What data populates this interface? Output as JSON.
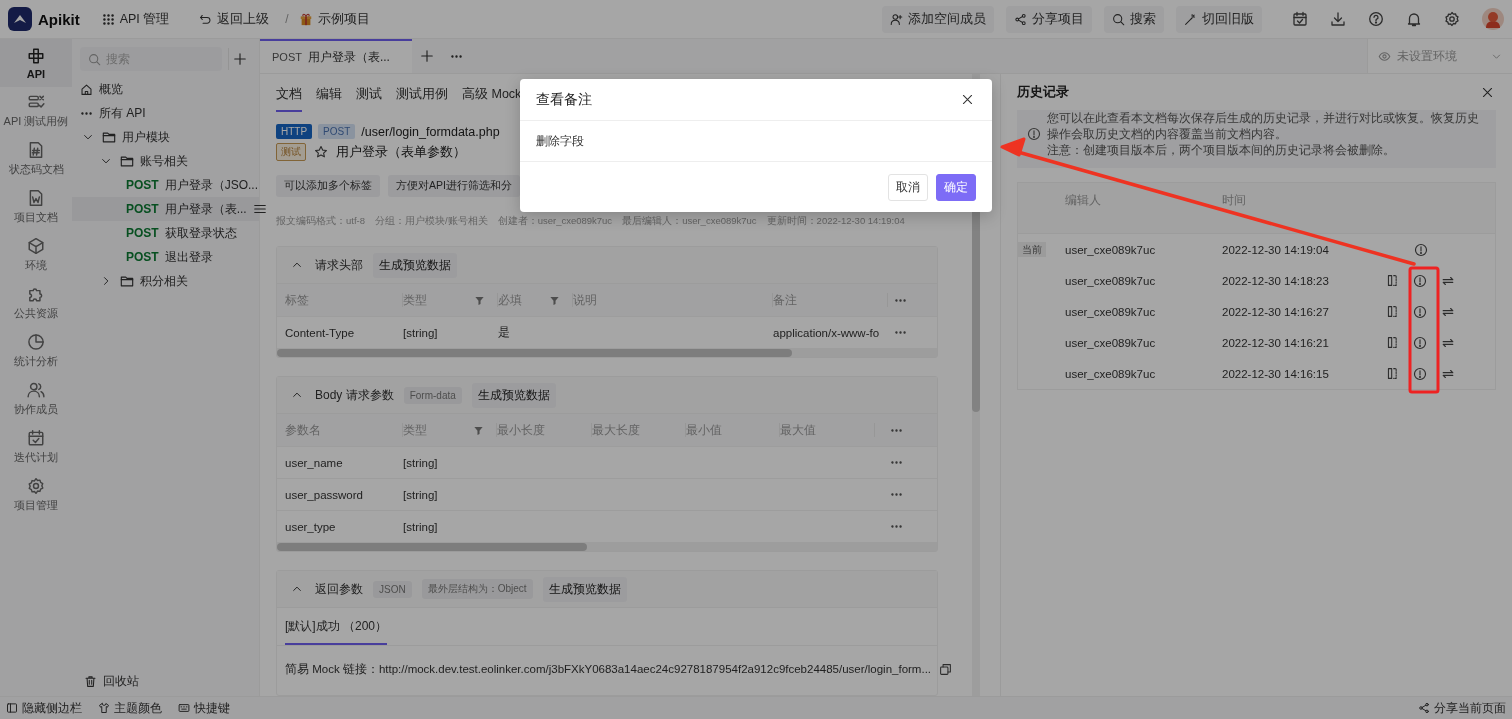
{
  "app": {
    "name": "Apikit"
  },
  "topbar": {
    "module": "API 管理",
    "back": "返回上级",
    "separator": "/",
    "project": "示例项目",
    "actions": [
      "添加空间成员",
      "分享项目",
      "搜索",
      "切回旧版"
    ]
  },
  "nav": [
    {
      "label": "API",
      "selected": true
    },
    {
      "label": "API 测试用例",
      "selected": false
    },
    {
      "label": "状态码文档",
      "selected": false
    },
    {
      "label": "项目文档",
      "selected": false
    },
    {
      "label": "环境",
      "selected": false
    },
    {
      "label": "公共资源",
      "selected": false
    },
    {
      "label": "统计分析",
      "selected": false
    },
    {
      "label": "协作成员",
      "selected": false
    },
    {
      "label": "迭代计划",
      "selected": false
    },
    {
      "label": "项目管理",
      "selected": false
    }
  ],
  "tree": {
    "search_placeholder": "搜索",
    "items": [
      {
        "kind": "overview",
        "label": "概览"
      },
      {
        "kind": "all",
        "label": "所有 API"
      },
      {
        "kind": "folder",
        "label": "用户模块",
        "expanded": true,
        "children": [
          {
            "kind": "folder",
            "label": "账号相关",
            "expanded": true,
            "children": [
              {
                "kind": "api",
                "method": "POST",
                "label": "用户登录（JSO...",
                "selected": false
              },
              {
                "kind": "api",
                "method": "POST",
                "label": "用户登录（表...",
                "selected": true
              },
              {
                "kind": "api",
                "method": "POST",
                "label": "获取登录状态",
                "selected": false
              },
              {
                "kind": "api",
                "method": "POST",
                "label": "退出登录",
                "selected": false
              }
            ]
          },
          {
            "kind": "folder",
            "label": "积分相关",
            "expanded": false
          }
        ]
      }
    ],
    "trash": "回收站"
  },
  "tabs": {
    "open": [
      {
        "method": "POST",
        "title": "用户登录（表...",
        "selected": true
      }
    ],
    "env": "未设置环境"
  },
  "doc": {
    "sub_tabs": [
      {
        "label": "文档",
        "selected": true
      },
      {
        "label": "编辑",
        "selected": false
      },
      {
        "label": "测试",
        "selected": false
      },
      {
        "label": "测试用例",
        "selected": false
      },
      {
        "label": "高级 Mock",
        "selected": false
      }
    ],
    "protocol": "HTTP",
    "method": "POST",
    "path": "/user/login_formdata.php",
    "status": "测试",
    "starred": false,
    "name": "用户登录（表单参数）",
    "tags": [
      "可以添加多个标签",
      "方便对API进行筛选和分"
    ],
    "meta": [
      "报文编码格式：utf-8",
      "分组：用户模块/账号相关",
      "创建者：user_cxe089k7uc",
      "最后编辑人：user_cxe089k7uc",
      "更新时间：2022-12-30 14:19:04"
    ],
    "sections": [
      {
        "kind": "table",
        "title": "请求头部",
        "expanded": true,
        "preview": "生成预览数据",
        "columns": [
          {
            "label": "标签",
            "filter": false
          },
          {
            "label": "类型",
            "filter": true
          },
          {
            "label": "必填",
            "filter": true
          },
          {
            "label": "说明",
            "filter": false
          },
          {
            "label": "备注",
            "filter": false
          }
        ],
        "rows": [
          {
            "cells": [
              "Content-Type",
              "[string]",
              "是",
              null,
              "application/x-www-fo"
            ]
          }
        ]
      },
      {
        "kind": "table",
        "title": "Body 请求参数",
        "expanded": true,
        "badges": [
          "Form-data"
        ],
        "preview": "生成预览数据",
        "columns": [
          {
            "label": "参数名",
            "filter": false
          },
          {
            "label": "类型",
            "filter": true
          },
          {
            "label": "最小长度",
            "filter": false
          },
          {
            "label": "最大长度",
            "filter": false
          },
          {
            "label": "最小值",
            "filter": false
          },
          {
            "label": "最大值",
            "filter": false
          }
        ],
        "rows": [
          {
            "cells": [
              "user_name",
              "[string]"
            ]
          },
          {
            "cells": [
              "user_password",
              "[string]"
            ]
          },
          {
            "cells": [
              "user_type",
              "[string]"
            ]
          }
        ]
      },
      {
        "kind": "response",
        "title": "返回参数",
        "expanded": true,
        "badges": [
          "JSON",
          "最外层结构为：Object"
        ],
        "preview": "生成预览数据",
        "response_tabs": [
          {
            "label": "[默认]成功 （200）",
            "selected": true
          }
        ],
        "mock_label": "简易 Mock 链接：",
        "mock_url": "http://mock.dev.test.eolinker.com/j3bFXkY0683a14aec24c9278187954f2a912c9fceb24485/user/login_form..."
      }
    ]
  },
  "history": {
    "title": "历史记录",
    "notice": [
      "您可以在此查看本文档每次保存后生成的历史记录，并进行对比或恢复。恢复历史操作会取历史文档的内容覆盖当前文档内容。",
      "注意：创建项目版本后，两个项目版本间的历史记录将会被删除。"
    ],
    "columns": [
      "编辑人",
      "时间"
    ],
    "rows": [
      {
        "tag": "当前",
        "current": true,
        "editor": "user_cxe089k7uc",
        "time": "2022-12-30 14:19:04"
      },
      {
        "current": false,
        "editor": "user_cxe089k7uc",
        "time": "2022-12-30 14:18:23"
      },
      {
        "current": false,
        "editor": "user_cxe089k7uc",
        "time": "2022-12-30 14:16:27"
      },
      {
        "current": false,
        "editor": "user_cxe089k7uc",
        "time": "2022-12-30 14:16:21"
      },
      {
        "current": false,
        "editor": "user_cxe089k7uc",
        "time": "2022-12-30 14:16:15"
      }
    ]
  },
  "modal": {
    "title": "查看备注",
    "body": "删除字段",
    "buttons": [
      {
        "label": "取消",
        "kind": "secondary"
      },
      {
        "label": "确定",
        "kind": "primary"
      }
    ]
  },
  "footer": {
    "items": [
      {
        "kind": "sidebar",
        "label": "隐藏侧边栏"
      },
      {
        "kind": "theme",
        "label": "主题颜色"
      },
      {
        "kind": "shortcut",
        "label": "快捷键"
      }
    ],
    "share": "分享当前页面"
  }
}
